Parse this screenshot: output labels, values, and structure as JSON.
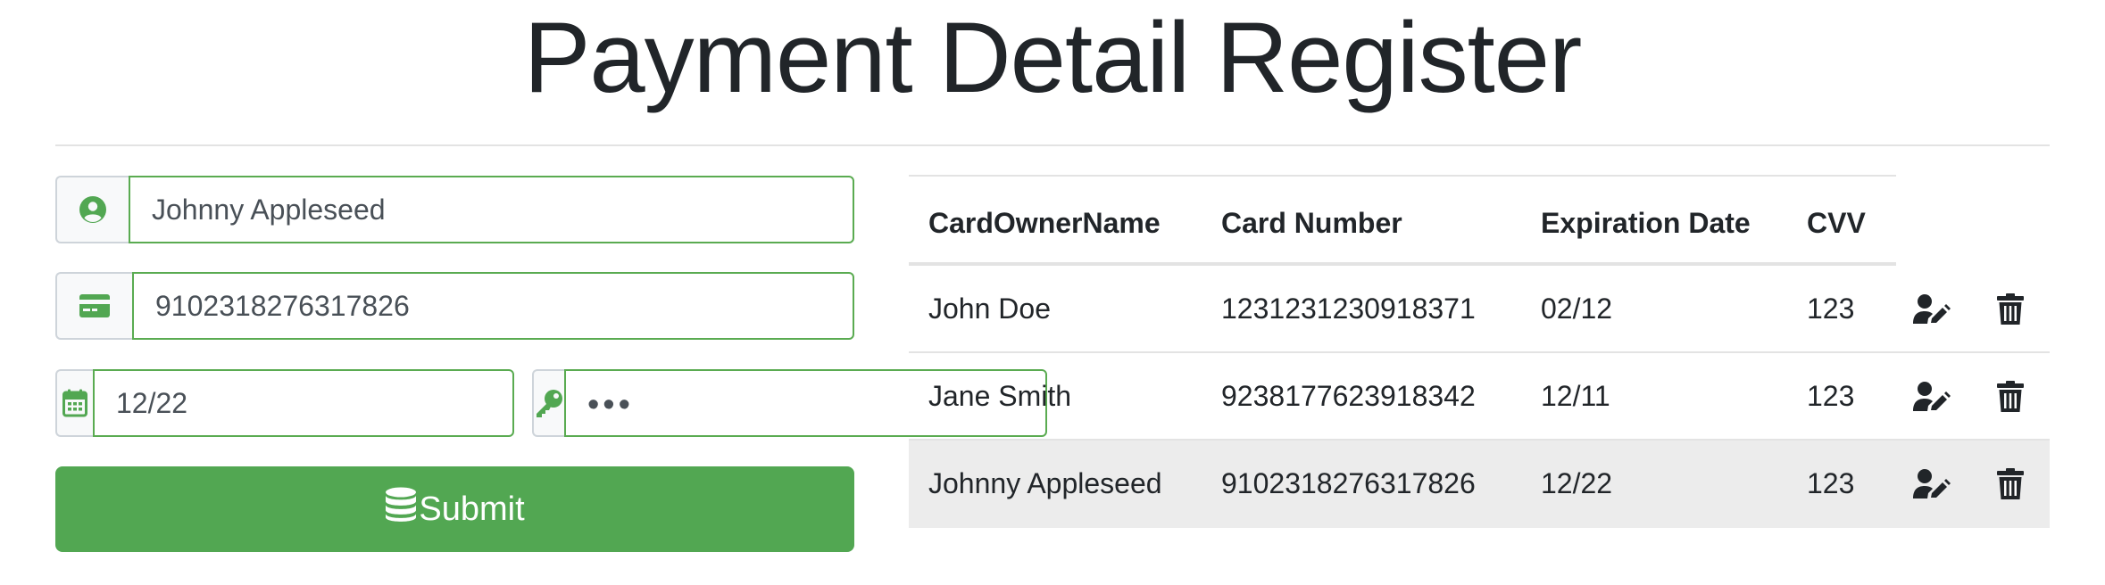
{
  "page": {
    "title": "Payment Detail Register"
  },
  "form": {
    "card_owner_name": {
      "value": "Johnny Appleseed",
      "icon": "user-circle-icon"
    },
    "card_number": {
      "value": "9102318276317826",
      "icon": "credit-card-icon"
    },
    "expiration_date": {
      "value": "12/22",
      "icon": "calendar-icon"
    },
    "cvv": {
      "value": "•••",
      "icon": "key-icon"
    },
    "submit_label": "Submit",
    "submit_icon": "database-icon"
  },
  "table": {
    "columns": [
      "CardOwnerName",
      "Card Number",
      "Expiration Date",
      "CVV"
    ],
    "rows": [
      {
        "owner": "John Doe",
        "card_number": "1231231230918371",
        "expiration": "02/12",
        "cvv": "123"
      },
      {
        "owner": "Jane Smith",
        "card_number": "9238177623918342",
        "expiration": "12/11",
        "cvv": "123"
      },
      {
        "owner": "Johnny Appleseed",
        "card_number": "9102318276317826",
        "expiration": "12/22",
        "cvv": "123",
        "highlighted": true
      }
    ],
    "row_actions": [
      "user-edit-icon",
      "trash-icon"
    ]
  },
  "colors": {
    "accent": "#52a752",
    "input_border": "#5aab51",
    "row_highlight": "#ececec",
    "text": "#212529"
  }
}
